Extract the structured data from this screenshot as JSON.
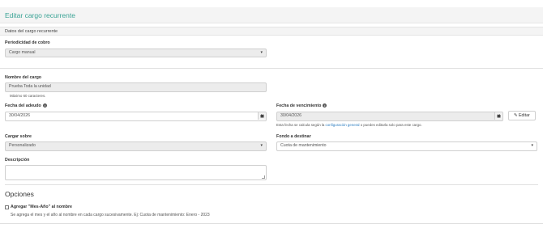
{
  "page": {
    "title": "Editar cargo recurrente"
  },
  "section": {
    "title": "Datos del cargo recurrente"
  },
  "periodicidad": {
    "label": "Periodicidad de cobro",
    "value": "Cargo manual"
  },
  "nombre": {
    "label": "Nombre del cargo",
    "value": "Prueba Toda la unidad",
    "help": "Máximo 60 caracteres."
  },
  "fecha_adeudo": {
    "label": "Fecha del adeudo",
    "value": "30/04/2026"
  },
  "fecha_vencimiento": {
    "label": "Fecha de vencimiento",
    "value": "30/04/2026",
    "help_prefix": "Esta fecha se calcula según la",
    "help_link": "configuración general",
    "help_suffix": "o puedes editarla solo para este cargo.",
    "edit_label": "Editar"
  },
  "cargar_sobre": {
    "label": "Cargar sobre",
    "value": "Personalizado"
  },
  "fondo": {
    "label": "Fondo a destinar",
    "value": "Cuota de mantenimiento"
  },
  "descripcion": {
    "label": "Descripción",
    "value": ""
  },
  "opciones": {
    "title": "Opciones",
    "checkbox_label": "Agregar \"Mes-Año\" al nombre",
    "checkbox_help": "Se agrega el mes y el año al nombre en cada cargo sucesivamente. Ej: Cuota de mantenimiento: Enero - 2023",
    "checked": false
  },
  "icons": [
    "info-icon",
    "calendar-icon",
    "chevron-down-icon",
    "pencil-icon"
  ],
  "colors": {
    "title": "#3aa395",
    "link": "#2a7bbf"
  }
}
